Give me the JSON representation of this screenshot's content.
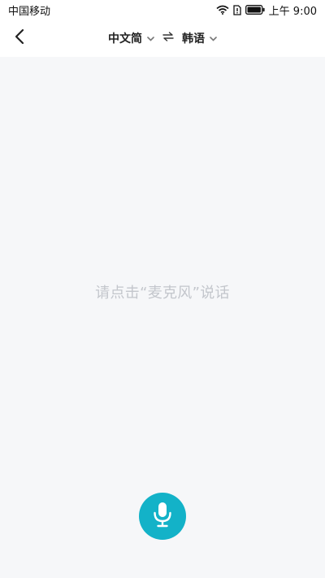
{
  "status_bar": {
    "carrier": "中国移动",
    "time": "上午 9:00",
    "icons": [
      "wifi-icon",
      "sim-icon",
      "battery-icon"
    ]
  },
  "header": {
    "back_icon": "chevron-left-icon",
    "source_language": "中文简",
    "target_language": "韩语",
    "swap_icon": "swap-arrows-icon",
    "dropdown_icon": "chevron-down-icon"
  },
  "main": {
    "hint": "请点击“麦克风”说话"
  },
  "mic": {
    "icon": "microphone-icon",
    "color": "#13b2c8"
  }
}
